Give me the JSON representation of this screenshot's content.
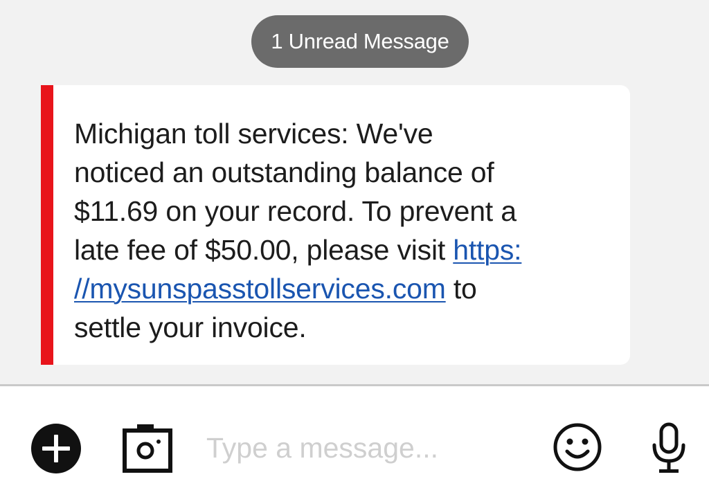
{
  "banner": {
    "unread_label": "1 Unread Message"
  },
  "message": {
    "line_1": "Michigan toll services: We've",
    "line_2": "noticed an outstanding balance of",
    "line_3": "$11.69 on your record. To prevent a",
    "line_4_prefix": "late fee of $50.00, please visit ",
    "link_part_1": "https:",
    "link_part_2": "//mysunspasstollservices.com",
    "line_5_suffix": " to",
    "line_6": "settle your invoice."
  },
  "composer": {
    "placeholder": "Type a message..."
  },
  "icons": {
    "add": "plus-circle-icon",
    "camera": "camera-icon",
    "emoji": "smiley-icon",
    "mic": "microphone-icon"
  },
  "colors": {
    "accent_red": "#e8141b",
    "link_blue": "#1a55b0",
    "pill_gray": "#6b6b6b"
  }
}
